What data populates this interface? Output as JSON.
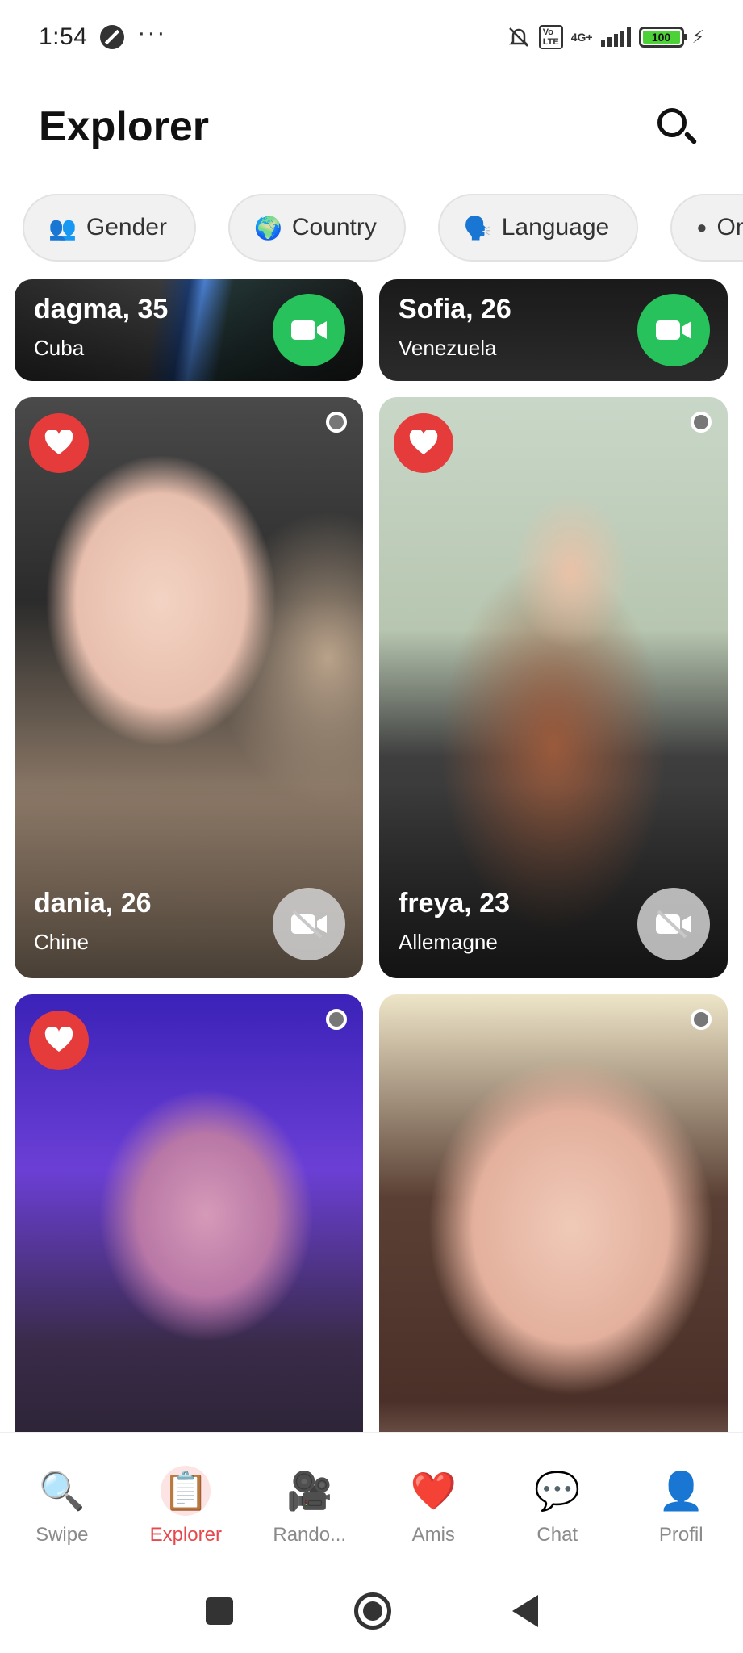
{
  "status_bar": {
    "time": "1:54",
    "network": "4G+",
    "battery": "100"
  },
  "header": {
    "title": "Explorer"
  },
  "filters": [
    {
      "icon": "👥",
      "label": "Gender"
    },
    {
      "icon": "🌍",
      "label": "Country"
    },
    {
      "icon": "🗣️",
      "label": "Language"
    },
    {
      "icon": "●",
      "label": "On"
    }
  ],
  "cards": [
    {
      "name": "dagma, 35",
      "country": "Cuba",
      "video": "available"
    },
    {
      "name": "Sofia, 26",
      "country": "Venezuela",
      "video": "available"
    },
    {
      "name": "dania, 26",
      "country": "Chine",
      "video": "unavailable"
    },
    {
      "name": "freya, 23",
      "country": "Allemagne",
      "video": "unavailable"
    },
    {
      "name": "",
      "country": ""
    },
    {
      "name": "",
      "country": ""
    }
  ],
  "nav": [
    {
      "label": "Swipe",
      "icon": "🔍"
    },
    {
      "label": "Explorer",
      "icon": "📋"
    },
    {
      "label": "Rando...",
      "icon": "🎥"
    },
    {
      "label": "Amis",
      "icon": "❤️"
    },
    {
      "label": "Chat",
      "icon": "💬"
    },
    {
      "label": "Profil",
      "icon": "👤"
    }
  ],
  "colors": {
    "accent": "#e5484d",
    "video_on": "#27c25c",
    "like": "#e53b3b"
  }
}
